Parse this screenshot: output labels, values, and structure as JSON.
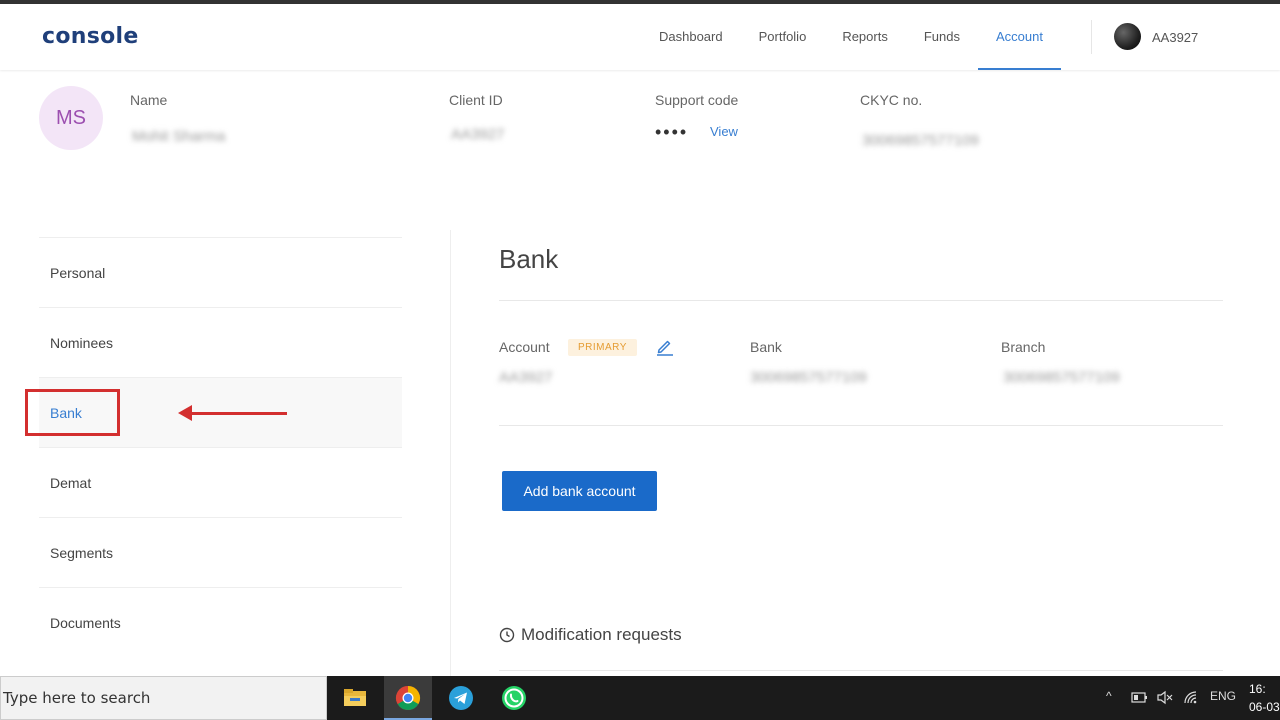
{
  "header": {
    "logo": "console",
    "nav": [
      "Dashboard",
      "Portfolio",
      "Reports",
      "Funds",
      "Account"
    ],
    "active_nav": "Account",
    "user_id": "AA3927"
  },
  "profile": {
    "initials": "MS",
    "name_label": "Name",
    "name_value": "Mohit Sharma",
    "client_id_label": "Client ID",
    "client_id_value": "AA3927",
    "support_code_label": "Support code",
    "support_code_masked": "••••",
    "support_code_link": "View",
    "ckyc_label": "CKYC no.",
    "ckyc_value": "30069857577109"
  },
  "sidebar": {
    "items": [
      "Personal",
      "Nominees",
      "Bank",
      "Demat",
      "Segments",
      "Documents"
    ],
    "active": "Bank"
  },
  "bank": {
    "title": "Bank",
    "account_label": "Account",
    "primary_badge": "PRIMARY",
    "account_value": "AA3927",
    "bank_label": "Bank",
    "bank_value": "30069857577109",
    "branch_label": "Branch",
    "branch_value": "30069857577109",
    "add_button": "Add bank account",
    "modification_requests": "Modification requests"
  },
  "taskbar": {
    "search_placeholder": "Type here to search",
    "lang": "ENG",
    "time": "16:",
    "date": "06-03"
  },
  "colors": {
    "accent": "#387ed1",
    "button": "#1a6ac9",
    "annotation": "#d32f2f",
    "badge_bg": "#fdf1de",
    "badge_text": "#e59c33"
  }
}
